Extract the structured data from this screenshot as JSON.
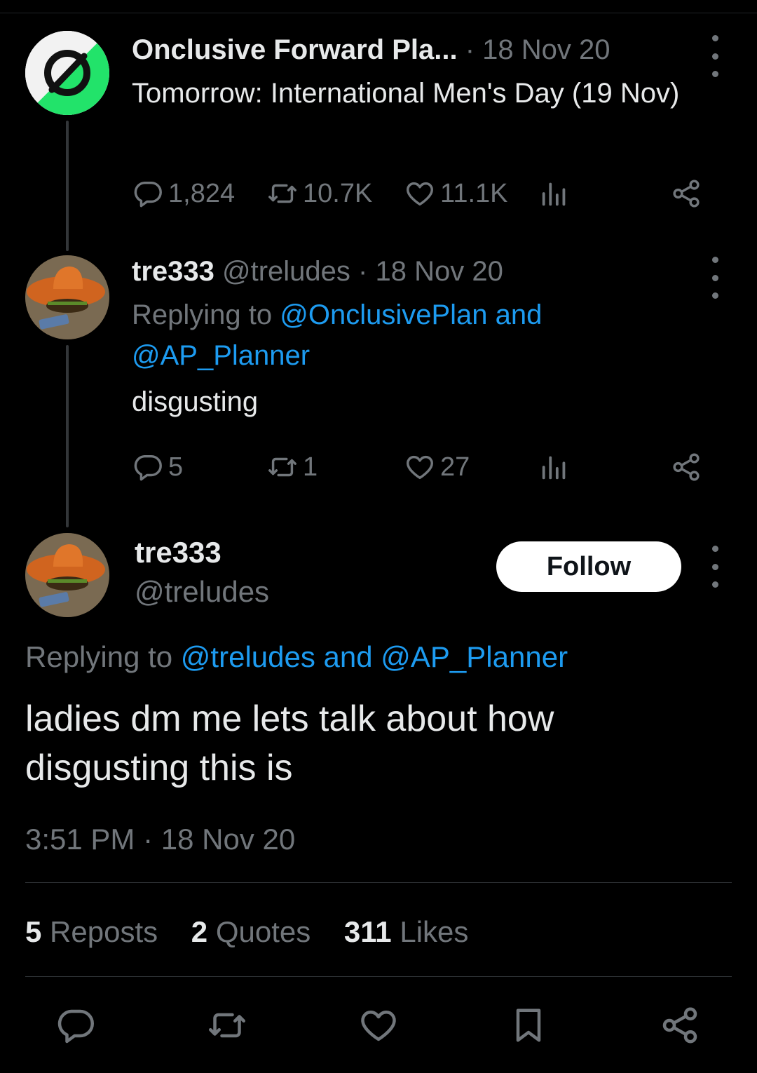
{
  "thread": [
    {
      "display_name": "Onclusive Forward Pla...",
      "date": "· 18 Nov 20",
      "text": "Tomorrow: International Men's Day (19 Nov)",
      "stats": {
        "replies": "1,824",
        "reposts": "10.7K",
        "likes": "11.1K"
      }
    },
    {
      "display_name": "tre333",
      "handle": "@treludes",
      "date": "· 18 Nov 20",
      "replying_prefix": "Replying to",
      "replying_mentions": "@OnclusivePlan and @AP_Planner",
      "text": "disgusting",
      "stats": {
        "replies": "5",
        "reposts": "1",
        "likes": "27"
      }
    }
  ],
  "main": {
    "display_name": "tre333",
    "handle": "@treludes",
    "follow_label": "Follow",
    "replying_prefix": "Replying to",
    "replying_mentions": "@treludes and @AP_Planner",
    "text": "ladies dm me lets talk about how disgusting this is",
    "timestamp": "3:51 PM · 18 Nov 20",
    "reposts_count": "5",
    "reposts_label": "Reposts",
    "quotes_count": "2",
    "quotes_label": "Quotes",
    "likes_count": "311",
    "likes_label": "Likes"
  },
  "icons": [
    "reply-icon",
    "repost-icon",
    "like-icon",
    "views-icon",
    "share-icon",
    "bookmark-icon",
    "more-icon"
  ],
  "colors": {
    "background": "#000000",
    "text": "#e7e9ea",
    "muted": "#71767b",
    "link": "#1d9bf0",
    "brand_green": "#22e36a"
  }
}
